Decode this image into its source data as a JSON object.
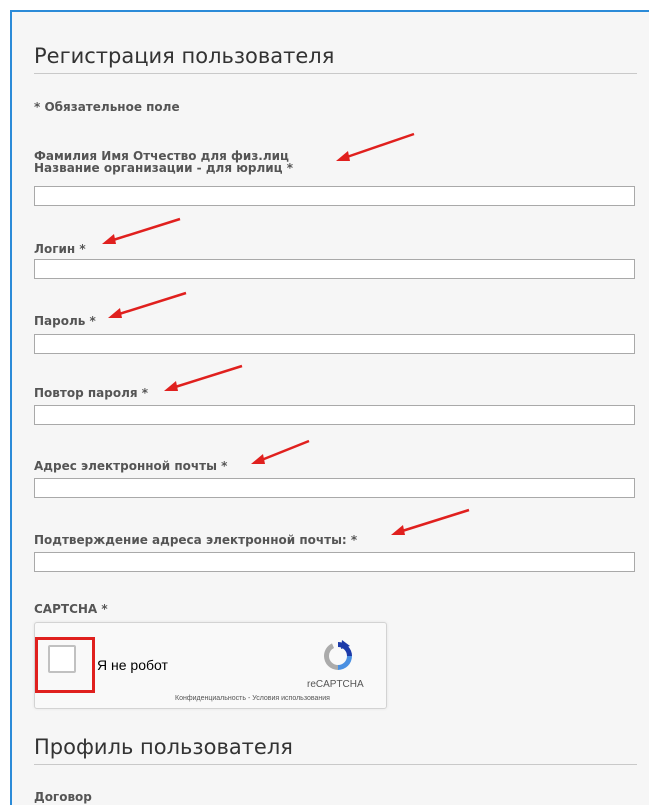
{
  "registration": {
    "title": "Регистрация пользователя",
    "required_note": "* Обязательное поле",
    "fields": [
      {
        "label_line1": "Фамилия Имя Отчество для физ.лиц",
        "label_line2": "Название организации - для юрлиц *",
        "value": ""
      },
      {
        "label_line1": "Логин *",
        "value": ""
      },
      {
        "label_line1": "Пароль *",
        "value": ""
      },
      {
        "label_line1": "Повтор пароля *",
        "value": ""
      },
      {
        "label_line1": "Адрес электронной почты *",
        "value": ""
      },
      {
        "label_line1": "Подтверждение адреса электронной почты: *",
        "value": ""
      }
    ],
    "captcha_label": "CAPTCHA *"
  },
  "recaptcha": {
    "checkbox_label": "Я не робот",
    "brand": "reCAPTCHA",
    "privacy_link": "Конфиденциальность",
    "separator": " - ",
    "terms_link": "Условия использования"
  },
  "profile": {
    "title": "Профиль пользователя",
    "contract_label": "Договор"
  },
  "colors": {
    "accent_border": "#2b8bd8",
    "annotation_red": "#e0201e",
    "panel_bg": "#f6f6f6"
  }
}
